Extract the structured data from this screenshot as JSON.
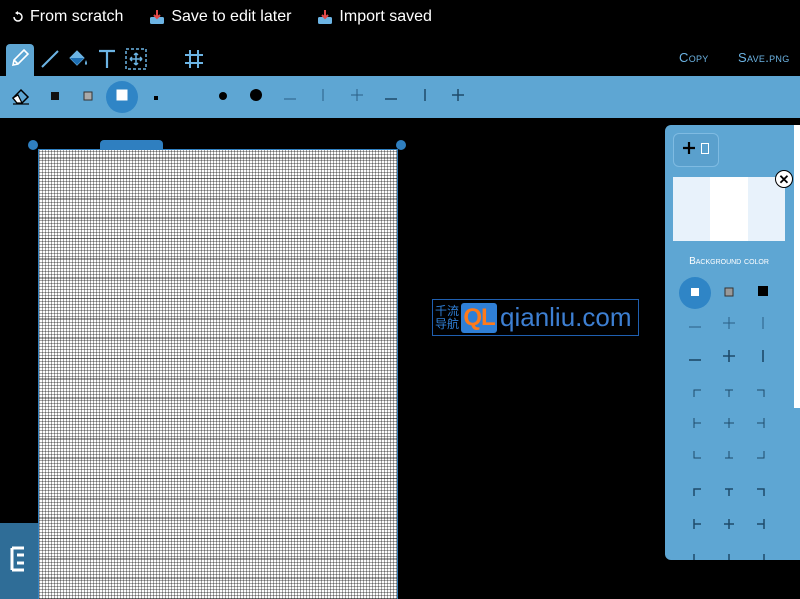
{
  "top_menu": {
    "from_scratch": "From scratch",
    "save_to_edit_later": "Save to edit later",
    "import_saved": "Import saved"
  },
  "header_links": {
    "copy": "Copy",
    "save_png": "Save.png"
  },
  "tools": [
    "pencil-icon",
    "line-icon",
    "fill-bucket-icon",
    "text-icon",
    "select-move-icon",
    "grid-icon"
  ],
  "active_tool": "pencil",
  "background_panel": {
    "label": "Background color",
    "swatch_colors": [
      "#e8f2fb",
      "#ffffff",
      "#e8f2fb"
    ]
  },
  "watermark": {
    "cn_line1": "千流",
    "cn_line2": "导航",
    "logo": "QL",
    "site": "qianliu.com"
  },
  "colors": {
    "accent": "#5ea6d3",
    "accent_dark": "#2f85c6",
    "link": "#6cb4e4"
  }
}
